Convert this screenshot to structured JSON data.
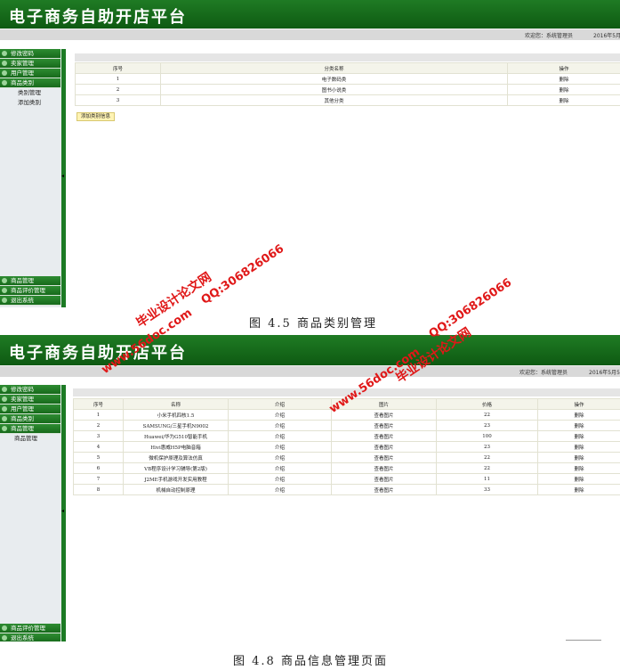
{
  "app_title": "电子商务自助开店平台",
  "welcome": "欢迎您：系统管理员",
  "date_text": "2016年5月5日",
  "sidebar_top": [
    "修改密码",
    "卖家管理",
    "用户管理",
    "商品类别"
  ],
  "category_submenu": [
    "类别管理",
    "添加类别"
  ],
  "sidebar_bottom_1": [
    "商品管理",
    "商品评价管理",
    "退出系统"
  ],
  "sidebar_top_2": [
    "修改密码",
    "卖家管理",
    "用户管理",
    "商品类别",
    "商品管理"
  ],
  "product_submenu": [
    "商品管理"
  ],
  "sidebar_bottom_2": [
    "商品评价管理",
    "退出系统"
  ],
  "category_table": {
    "headers": [
      "序号",
      "分类名称",
      "操作"
    ],
    "rows": [
      [
        "1",
        "电子数码类",
        "删除"
      ],
      [
        "2",
        "图书小说类",
        "删除"
      ],
      [
        "3",
        "其他分类",
        "删除"
      ]
    ]
  },
  "add_category_button": "添加类别信息",
  "caption1": "图 4.5 商品类别管理",
  "product_table": {
    "headers": [
      "序号",
      "名称",
      "介绍",
      "图片",
      "价格",
      "操作"
    ],
    "rows": [
      [
        "1",
        "小米手机四核1.5",
        "介绍",
        "查看图片",
        "22",
        "删除"
      ],
      [
        "2",
        "SAMSUNG/三星手机N9002",
        "介绍",
        "查看图片",
        "23",
        "删除"
      ],
      [
        "3",
        "Huawei/华为G510智能手机",
        "介绍",
        "查看图片",
        "100",
        "删除"
      ],
      [
        "4",
        "Hivi惠威H5P电脑音箱",
        "介绍",
        "查看图片",
        "23",
        "删除"
      ],
      [
        "5",
        "微机保护原理及算法仿真",
        "介绍",
        "查看图片",
        "22",
        "删除"
      ],
      [
        "6",
        "VB程序设计学习辅导(第2版)",
        "介绍",
        "查看图片",
        "22",
        "删除"
      ],
      [
        "7",
        "J2ME手机游戏开发实用教程",
        "介绍",
        "查看图片",
        "11",
        "删除"
      ],
      [
        "8",
        "机械自动控制原理",
        "介绍",
        "查看图片",
        "33",
        "删除"
      ]
    ]
  },
  "caption2": "图 4.8 商品信息管理页面",
  "watermark": {
    "cn": "毕业设计论文网",
    "url": "www.56doc.com",
    "qq": "QQ:306826066"
  }
}
